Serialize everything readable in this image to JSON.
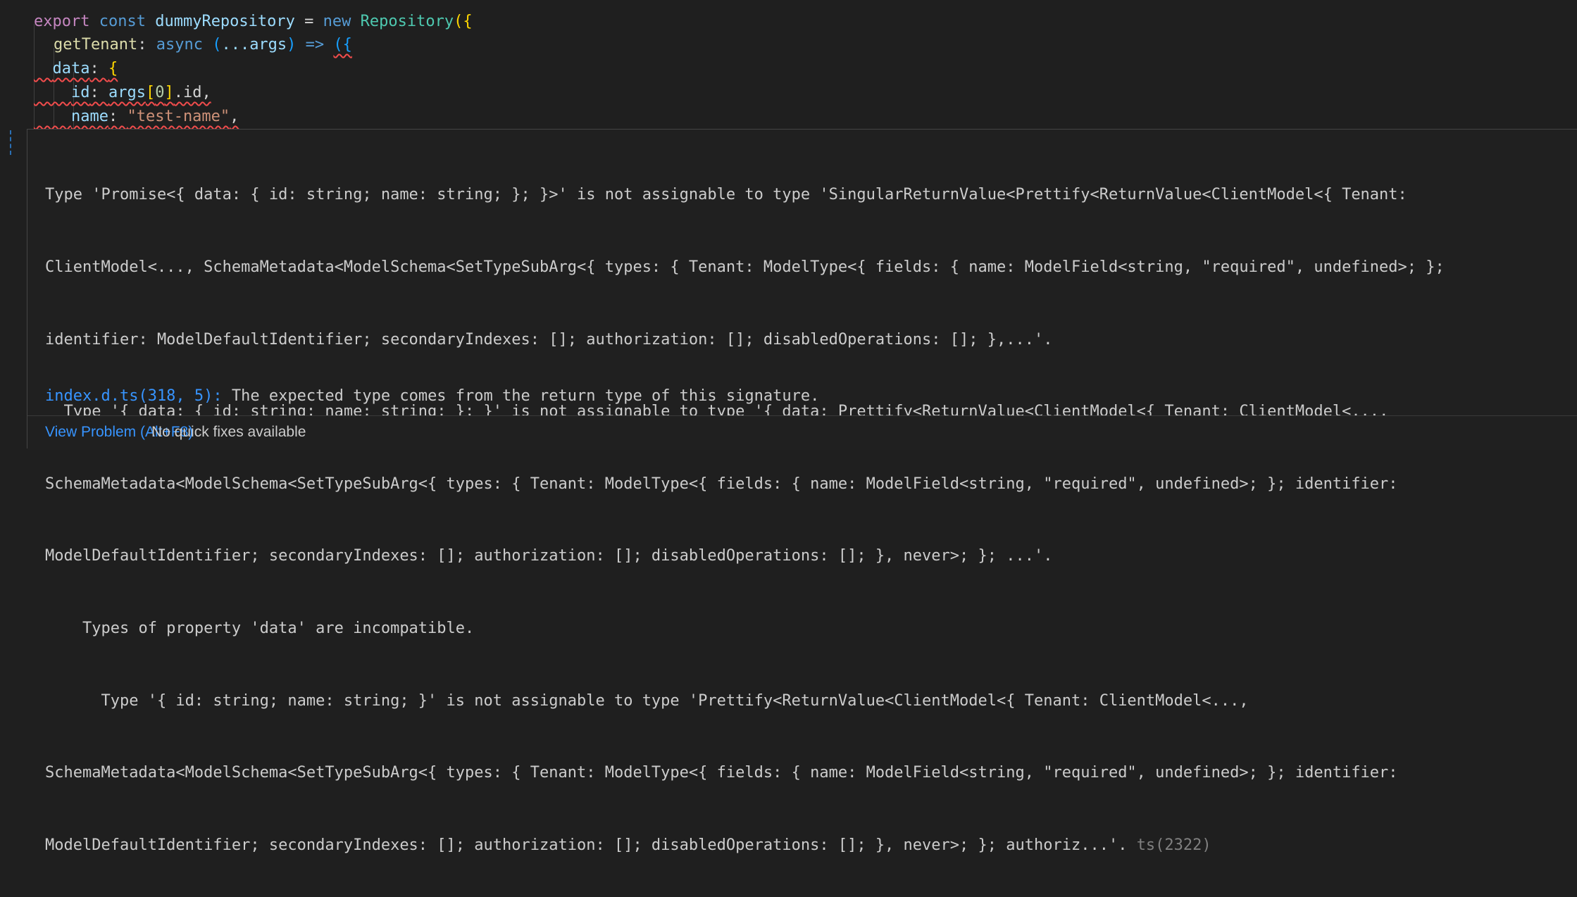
{
  "editor": {
    "line1": {
      "kw_export": "export",
      "kw_const": "const",
      "var_name": "dummyRepository",
      "eq": " = ",
      "kw_new": "new",
      "class_name": "Repository",
      "open": "({"
    },
    "line2": {
      "prop": "getTenant",
      "colon": ": ",
      "kw_async": "async",
      "params_open": "(",
      "params": "...args",
      "params_close": ")",
      "arrow": " => ",
      "open": "({"
    },
    "line3": {
      "prop": "data",
      "colon": ": ",
      "open": "{"
    },
    "line4": {
      "prop": "id",
      "colon": ": ",
      "obj": "args",
      "index": "0",
      "rest": ".id,"
    },
    "line5": {
      "prop": "name",
      "colon": ": ",
      "value": "\"test-name\"",
      "comma": ","
    }
  },
  "hover": {
    "message_lines": [
      "Type 'Promise<{ data: { id: string; name: string; }; }>' is not assignable to type 'SingularReturnValue<Prettify<ReturnValue<ClientModel<{ Tenant:",
      "ClientModel<..., SchemaMetadata<ModelSchema<SetTypeSubArg<{ types: { Tenant: ModelType<{ fields: { name: ModelField<string, \"required\", undefined>; };",
      "identifier: ModelDefaultIdentifier; secondaryIndexes: []; authorization: []; disabledOperations: []; },...'.",
      "  Type '{ data: { id: string; name: string; }; }' is not assignable to type '{ data: Prettify<ReturnValue<ClientModel<{ Tenant: ClientModel<...,",
      "SchemaMetadata<ModelSchema<SetTypeSubArg<{ types: { Tenant: ModelType<{ fields: { name: ModelField<string, \"required\", undefined>; }; identifier:",
      "ModelDefaultIdentifier; secondaryIndexes: []; authorization: []; disabledOperations: []; }, never>; }; ...'.",
      "    Types of property 'data' are incompatible.",
      "      Type '{ id: string; name: string; }' is not assignable to type 'Prettify<ReturnValue<ClientModel<{ Tenant: ClientModel<...,",
      "SchemaMetadata<ModelSchema<SetTypeSubArg<{ types: { Tenant: ModelType<{ fields: { name: ModelField<string, \"required\", undefined>; }; identifier:",
      "ModelDefaultIdentifier; secondaryIndexes: []; authorization: []; disabledOperations: []; }, never>; }; authoriz...'. "
    ],
    "error_code": "ts(2322)",
    "related_location": "index.d.ts(318, 5):",
    "related_message": " The expected type comes from the return type of this signature.",
    "view_problem": "View Problem (Alt+F8)",
    "no_quick_fixes": "No quick fixes available"
  }
}
